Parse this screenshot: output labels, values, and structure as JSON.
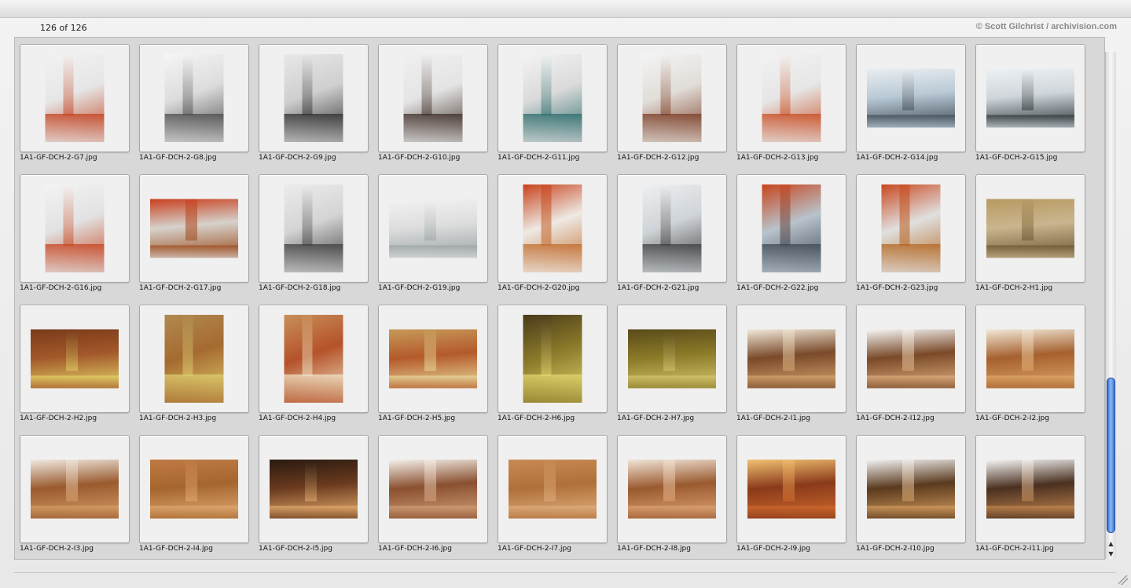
{
  "status": {
    "count_text": "126 of 126",
    "copyright": "© Scott Gilchrist / archivision.com"
  },
  "scrollbar": {
    "up_arrow": "▲",
    "down_arrow": "▼",
    "position_fraction": 0.73
  },
  "thumbnails": [
    {
      "file": "1A1-GF-DCH-2-G7.jpg",
      "orientation": "portrait",
      "colors": [
        "#e6e6e6",
        "#c23f1c",
        "#f2f2f2"
      ]
    },
    {
      "file": "1A1-GF-DCH-2-G8.jpg",
      "orientation": "portrait",
      "colors": [
        "#dcdcdc",
        "#4a4a4a",
        "#f5f5f5"
      ]
    },
    {
      "file": "1A1-GF-DCH-2-G9.jpg",
      "orientation": "portrait",
      "colors": [
        "#cfcfcf",
        "#2c2c2c",
        "#e8e8e8"
      ]
    },
    {
      "file": "1A1-GF-DCH-2-G10.jpg",
      "orientation": "portrait",
      "colors": [
        "#e4e4e4",
        "#3a2a22",
        "#f0f0f0"
      ]
    },
    {
      "file": "1A1-GF-DCH-2-G11.jpg",
      "orientation": "portrait",
      "colors": [
        "#dadada",
        "#2a6b6b",
        "#f3f3f3"
      ]
    },
    {
      "file": "1A1-GF-DCH-2-G12.jpg",
      "orientation": "portrait",
      "colors": [
        "#e1ddd8",
        "#7a3a22",
        "#f4f4f4"
      ]
    },
    {
      "file": "1A1-GF-DCH-2-G13.jpg",
      "orientation": "portrait",
      "colors": [
        "#e6e6e6",
        "#c84a1e",
        "#f2f2f2"
      ]
    },
    {
      "file": "1A1-GF-DCH-2-G14.jpg",
      "orientation": "landscape",
      "colors": [
        "#b9c9d6",
        "#3f4b55",
        "#e9eef2"
      ]
    },
    {
      "file": "1A1-GF-DCH-2-G15.jpg",
      "orientation": "landscape",
      "colors": [
        "#cfd6db",
        "#2d3438",
        "#eef1f3"
      ]
    },
    {
      "file": "1A1-GF-DCH-2-G16.jpg",
      "orientation": "portrait",
      "colors": [
        "#e2e2e2",
        "#c5421c",
        "#f3f3f3"
      ]
    },
    {
      "file": "1A1-GF-DCH-2-G17.jpg",
      "orientation": "landscape",
      "colors": [
        "#d6d2cc",
        "#9c4a1c",
        "#c8401e"
      ]
    },
    {
      "file": "1A1-GF-DCH-2-G18.jpg",
      "orientation": "portrait",
      "colors": [
        "#d4d4d4",
        "#3b3b3b",
        "#ececec"
      ]
    },
    {
      "file": "1A1-GF-DCH-2-G19.jpg",
      "orientation": "landscape",
      "colors": [
        "#dedede",
        "#9aa3a6",
        "#f2f2f2"
      ]
    },
    {
      "file": "1A1-GF-DCH-2-G20.jpg",
      "orientation": "portrait",
      "colors": [
        "#eeeae4",
        "#c06a2a",
        "#c8421c"
      ]
    },
    {
      "file": "1A1-GF-DCH-2-G21.jpg",
      "orientation": "portrait",
      "colors": [
        "#cfd4d8",
        "#3c3c3c",
        "#eef0f2"
      ]
    },
    {
      "file": "1A1-GF-DCH-2-G22.jpg",
      "orientation": "portrait",
      "colors": [
        "#b8c3cc",
        "#3b4550",
        "#c8441c"
      ]
    },
    {
      "file": "1A1-GF-DCH-2-G23.jpg",
      "orientation": "portrait",
      "colors": [
        "#e0e0e0",
        "#b4651e",
        "#c8481e"
      ]
    },
    {
      "file": "1A1-GF-DCH-2-H1.jpg",
      "orientation": "landscape",
      "colors": [
        "#c9b58e",
        "#6b5431",
        "#b89a62"
      ]
    },
    {
      "file": "1A1-GF-DCH-2-H2.jpg",
      "orientation": "landscape",
      "colors": [
        "#a2582a",
        "#e6d66a",
        "#7a3a1a"
      ]
    },
    {
      "file": "1A1-GF-DCH-2-H3.jpg",
      "orientation": "portrait",
      "colors": [
        "#a56a30",
        "#e0d070",
        "#b08a50"
      ]
    },
    {
      "file": "1A1-GF-DCH-2-H4.jpg",
      "orientation": "portrait",
      "colors": [
        "#b5522a",
        "#f0e6c8",
        "#c8905a"
      ]
    },
    {
      "file": "1A1-GF-DCH-2-H5.jpg",
      "orientation": "landscape",
      "colors": [
        "#b45a2a",
        "#e8dca0",
        "#c79a5a"
      ]
    },
    {
      "file": "1A1-GF-DCH-2-H6.jpg",
      "orientation": "portrait",
      "colors": [
        "#8a7a2a",
        "#e6d870",
        "#4a3a1a"
      ]
    },
    {
      "file": "1A1-GF-DCH-2-H7.jpg",
      "orientation": "landscape",
      "colors": [
        "#8a7a28",
        "#d8c870",
        "#5a4a1a"
      ]
    },
    {
      "file": "1A1-GF-DCH-2-I1.jpg",
      "orientation": "landscape",
      "colors": [
        "#7a4a2a",
        "#d8a870",
        "#f0e8d8"
      ]
    },
    {
      "file": "1A1-GF-DCH-2-I12.jpg",
      "orientation": "landscape",
      "colors": [
        "#7a4a28",
        "#e0b080",
        "#f5f5f5"
      ]
    },
    {
      "file": "1A1-GF-DCH-2-I2.jpg",
      "orientation": "landscape",
      "colors": [
        "#a5602e",
        "#e0a868",
        "#f2e8d8"
      ]
    },
    {
      "file": "1A1-GF-DCH-2-I3.jpg",
      "orientation": "landscape",
      "colors": [
        "#9a5a2e",
        "#d8a06a",
        "#f0e8e0"
      ]
    },
    {
      "file": "1A1-GF-DCH-2-I4.jpg",
      "orientation": "landscape",
      "colors": [
        "#a5662e",
        "#e2ac74",
        "#c07a44"
      ]
    },
    {
      "file": "1A1-GF-DCH-2-I5.jpg",
      "orientation": "landscape",
      "colors": [
        "#6a3a1e",
        "#e8b070",
        "#2a1a10"
      ]
    },
    {
      "file": "1A1-GF-DCH-2-I6.jpg",
      "orientation": "landscape",
      "colors": [
        "#8a5030",
        "#d4a27a",
        "#f4f0ea"
      ]
    },
    {
      "file": "1A1-GF-DCH-2-I7.jpg",
      "orientation": "landscape",
      "colors": [
        "#b0703a",
        "#e0b080",
        "#c88a54"
      ]
    },
    {
      "file": "1A1-GF-DCH-2-I8.jpg",
      "orientation": "landscape",
      "colors": [
        "#9a5a30",
        "#e0a676",
        "#f0e4d6"
      ]
    },
    {
      "file": "1A1-GF-DCH-2-I9.jpg",
      "orientation": "landscape",
      "colors": [
        "#8a3a1a",
        "#d06a2e",
        "#f0c070"
      ]
    },
    {
      "file": "1A1-GF-DCH-2-I10.jpg",
      "orientation": "landscape",
      "colors": [
        "#5a3a1e",
        "#d8a060",
        "#f2f2f2"
      ]
    },
    {
      "file": "1A1-GF-DCH-2-I11.jpg",
      "orientation": "landscape",
      "colors": [
        "#4a3020",
        "#c88a50",
        "#f5f5f5"
      ]
    }
  ]
}
